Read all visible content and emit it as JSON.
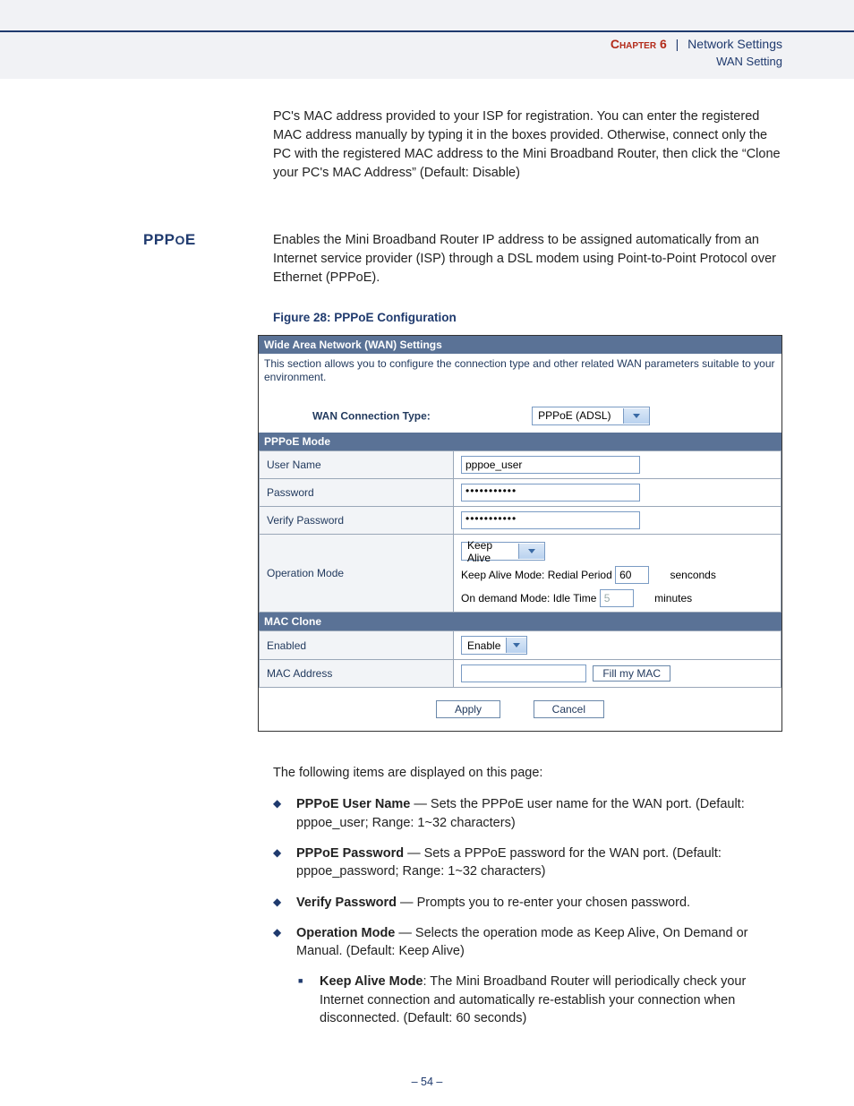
{
  "header": {
    "chapter": "Chapter 6",
    "separator": "|",
    "section": "Network Settings",
    "subsection": "WAN Setting"
  },
  "intro_prev": "PC's MAC address provided to your ISP for registration. You can enter the registered MAC address manually by typing it in the boxes provided. Otherwise, connect only the PC with the registered MAC address to the Mini Broadband Router, then click the “Clone your PC's MAC Address” (Default: Disable)",
  "pppoe": {
    "title": "PPPoE",
    "para": "Enables the Mini Broadband Router IP address to be assigned automatically from an Internet service provider (ISP) through a DSL modem using Point-to-Point Protocol over Ethernet (PPPoE)."
  },
  "figure": {
    "caption": "Figure 28:  PPPoE Configuration",
    "title": "Wide Area Network (WAN) Settings",
    "desc": "This section allows you to configure the connection type and other related WAN parameters suitable to your environment.",
    "wan_conn_label": "WAN Connection Type:",
    "wan_conn_value": "PPPoE (ADSL)",
    "mode_header": "PPPoE Mode",
    "rows": {
      "user_label": "User Name",
      "user_value": "pppoe_user",
      "pass_label": "Password",
      "pass_value": "•••••••••••",
      "verify_label": "Verify Password",
      "verify_value": "•••••••••••",
      "op_label": "Operation Mode",
      "op_value": "Keep Alive",
      "op_line1a": "Keep Alive Mode: Redial Period",
      "op_line1b": "60",
      "op_line1c": "senconds",
      "op_line2a": "On demand Mode: Idle Time",
      "op_line2b": "5",
      "op_line2c": "minutes"
    },
    "mac_header": "MAC Clone",
    "mac": {
      "enabled_label": "Enabled",
      "enabled_value": "Enable",
      "addr_label": "MAC Address",
      "addr_value": "",
      "fill_btn": "Fill my MAC"
    },
    "apply": "Apply",
    "cancel": "Cancel"
  },
  "items_intro": "The following items are displayed on this page:",
  "bullets": {
    "b1_t": "PPPoE User Name",
    "b1_d": " — Sets the PPPoE user name for the WAN port. (Default: pppoe_user; Range: 1~32 characters)",
    "b2_t": "PPPoE Password",
    "b2_d": " — Sets a PPPoE password for the WAN port. (Default: pppoe_password; Range: 1~32 characters)",
    "b3_t": "Verify Password",
    "b3_d": " — Prompts you to re-enter your chosen password.",
    "b4_t": "Operation Mode",
    "b4_d": " — Selects the operation mode as Keep Alive, On Demand or Manual. (Default: Keep Alive)",
    "s1_t": "Keep Alive Mode",
    "s1_d": ": The Mini Broadband Router will periodically check your Internet connection and automatically re-establish your connection when disconnected. (Default: 60 seconds)"
  },
  "page_number": "–  54  –"
}
